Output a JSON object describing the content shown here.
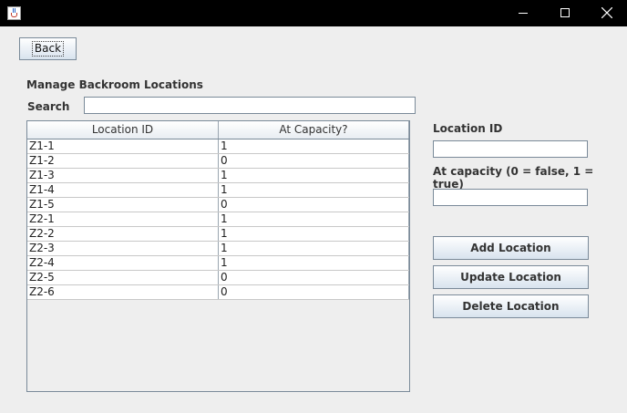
{
  "window": {
    "icon": "java-coffee-cup-icon",
    "controls": [
      "minimize-icon",
      "maximize-icon",
      "close-icon"
    ]
  },
  "toolbar": {
    "back_label": "Back"
  },
  "main": {
    "title": "Manage Backroom Locations",
    "search_label": "Search",
    "search_value": ""
  },
  "table": {
    "columns": [
      "Location ID",
      "At Capacity?"
    ],
    "rows": [
      [
        "Z1-1",
        "1"
      ],
      [
        "Z1-2",
        "0"
      ],
      [
        "Z1-3",
        "1"
      ],
      [
        "Z1-4",
        "1"
      ],
      [
        "Z1-5",
        "0"
      ],
      [
        "Z2-1",
        "1"
      ],
      [
        "Z2-2",
        "1"
      ],
      [
        "Z2-3",
        "1"
      ],
      [
        "Z2-4",
        "1"
      ],
      [
        "Z2-5",
        "0"
      ],
      [
        "Z2-6",
        "0"
      ]
    ]
  },
  "form": {
    "location_id_label": "Location ID",
    "location_id_value": "",
    "capacity_label": "At capacity (0 = false, 1 = true)",
    "capacity_value": ""
  },
  "actions": {
    "add_label": "Add Location",
    "update_label": "Update Location",
    "delete_label": "Delete Location"
  },
  "colors": {
    "titlebar": "#000000",
    "window_background": "#eeeeee",
    "border": "#7a8a99"
  }
}
